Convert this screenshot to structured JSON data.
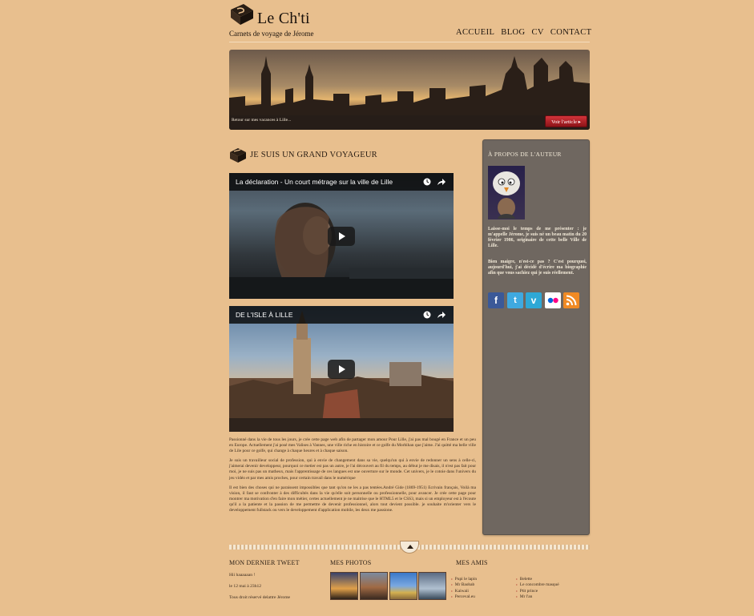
{
  "header": {
    "site_title": "Le Ch'ti",
    "tagline": "Carnets de voyage de Jérome",
    "nav": [
      "ACCUEIL",
      "BLOG",
      "CV",
      "CONTACT"
    ]
  },
  "hero": {
    "caption": "Retour sur mes vacances à Lille...",
    "button_label": "Voir l'article ▸"
  },
  "main": {
    "section_title": "JE SUIS UN GRAND VOYAGEUR",
    "videos": [
      {
        "title": "La déclaration - Un court métrage sur la ville de Lille"
      },
      {
        "title": "DE L'ISLE À LILLE"
      }
    ],
    "paragraphs": [
      "Passionné dans la vie de tous les jours, je crée cette page web afin de partager mon amour Pour Lille, j'ai pas mal bougé en France et un peu en Europe. Actuellement j'ai posé mes Valises à Vannes, une ville riche en histoire et ce golfe du Morbihan que j'aime. J'ai quitté ma belle ville de Lile pour ce golfe, qui change à chaque heures et à chaque saison.",
      "Je suis un travailleur social de profession, qui à envie de changement dans sa vie, quelqu'un qui à envie de redonner un sens à celle-ci, j'aimerai devenir developpeur, pourquoi ce metier est pas un autre, je l'ai découvert au fil du temps, au début je me disais, il n'est pas fait pour moi, je ne suis pas un matheux, mais l'apprentissage de ces langues est une ouverture sur le monde. Cet univers, je le cotoie dans l'univers du jeu vidéo et par mes amis proches, pour certain travail dans le numérique",
      "Il est bien des choses qui ne paraissent impossibles que tant qu'on ne les a pas tentées.André Gide (1869-1951) Ecrivain français, Voilà ma vision, il faut se confronter à des difficultés dans la vie qu'elle soit personnelle ou professionnelle, pour avancer. Je crée cette page pour montrer ma motivation d'en faire mon métier, certes actuellement je ne maitrise que le HTML5 et le CSS3, mais si un employeur est à l'écoute qu'il a la patiente et la passion de me permettre de devenir professionnel, alors tout devient possible. je souhaite m'orienter vers le developpement fullstack ou vers le developpement d'application mobile, les deux me passione."
    ]
  },
  "sidebar": {
    "title": "À PROPOS DE L'AUTEUR",
    "para1": "Laisse-moi le temps de me présenter : je m'appelle Jérome, je suis né un beau matin du 20 février 1986, originaire de cette belle Ville de Lille.",
    "para2": "Bien maigre, n'est-ce pas ? C'est pourquoi, aujourd'hui, j'ai décidé d'écrire ma biographie afin que vous sachiez qui je suis réellement.",
    "social": [
      {
        "icon": "facebook-icon",
        "glyph": "f",
        "color": "#3b5998"
      },
      {
        "icon": "twitter-icon",
        "glyph": "t",
        "color": "#3fa9e0"
      },
      {
        "icon": "vimeo-icon",
        "glyph": "v",
        "color": "#2ea8d6"
      },
      {
        "icon": "flickr-icon",
        "glyph": "●●",
        "color": "#ffffff"
      },
      {
        "icon": "rss-icon",
        "glyph": "◉",
        "color": "#f08a24"
      }
    ]
  },
  "footer": {
    "tweet_heading": "MON DERNIER TWEET",
    "tweet_text": "Hii haaaaaan !",
    "tweet_date": "le 12 mai à 23h12",
    "copyright": "Tous droit réservé delattre Jérome",
    "photos_heading": "MES PHOTOS",
    "friends_heading": "MES AMIS",
    "friends_col1": [
      "Pupi le lapin",
      "Mr Baobab",
      "Kaiwaii",
      "Perceval.eu"
    ],
    "friends_col2": [
      "Belette",
      "Le concombre masqué",
      "Ptit prince",
      "Mr l'an"
    ]
  }
}
